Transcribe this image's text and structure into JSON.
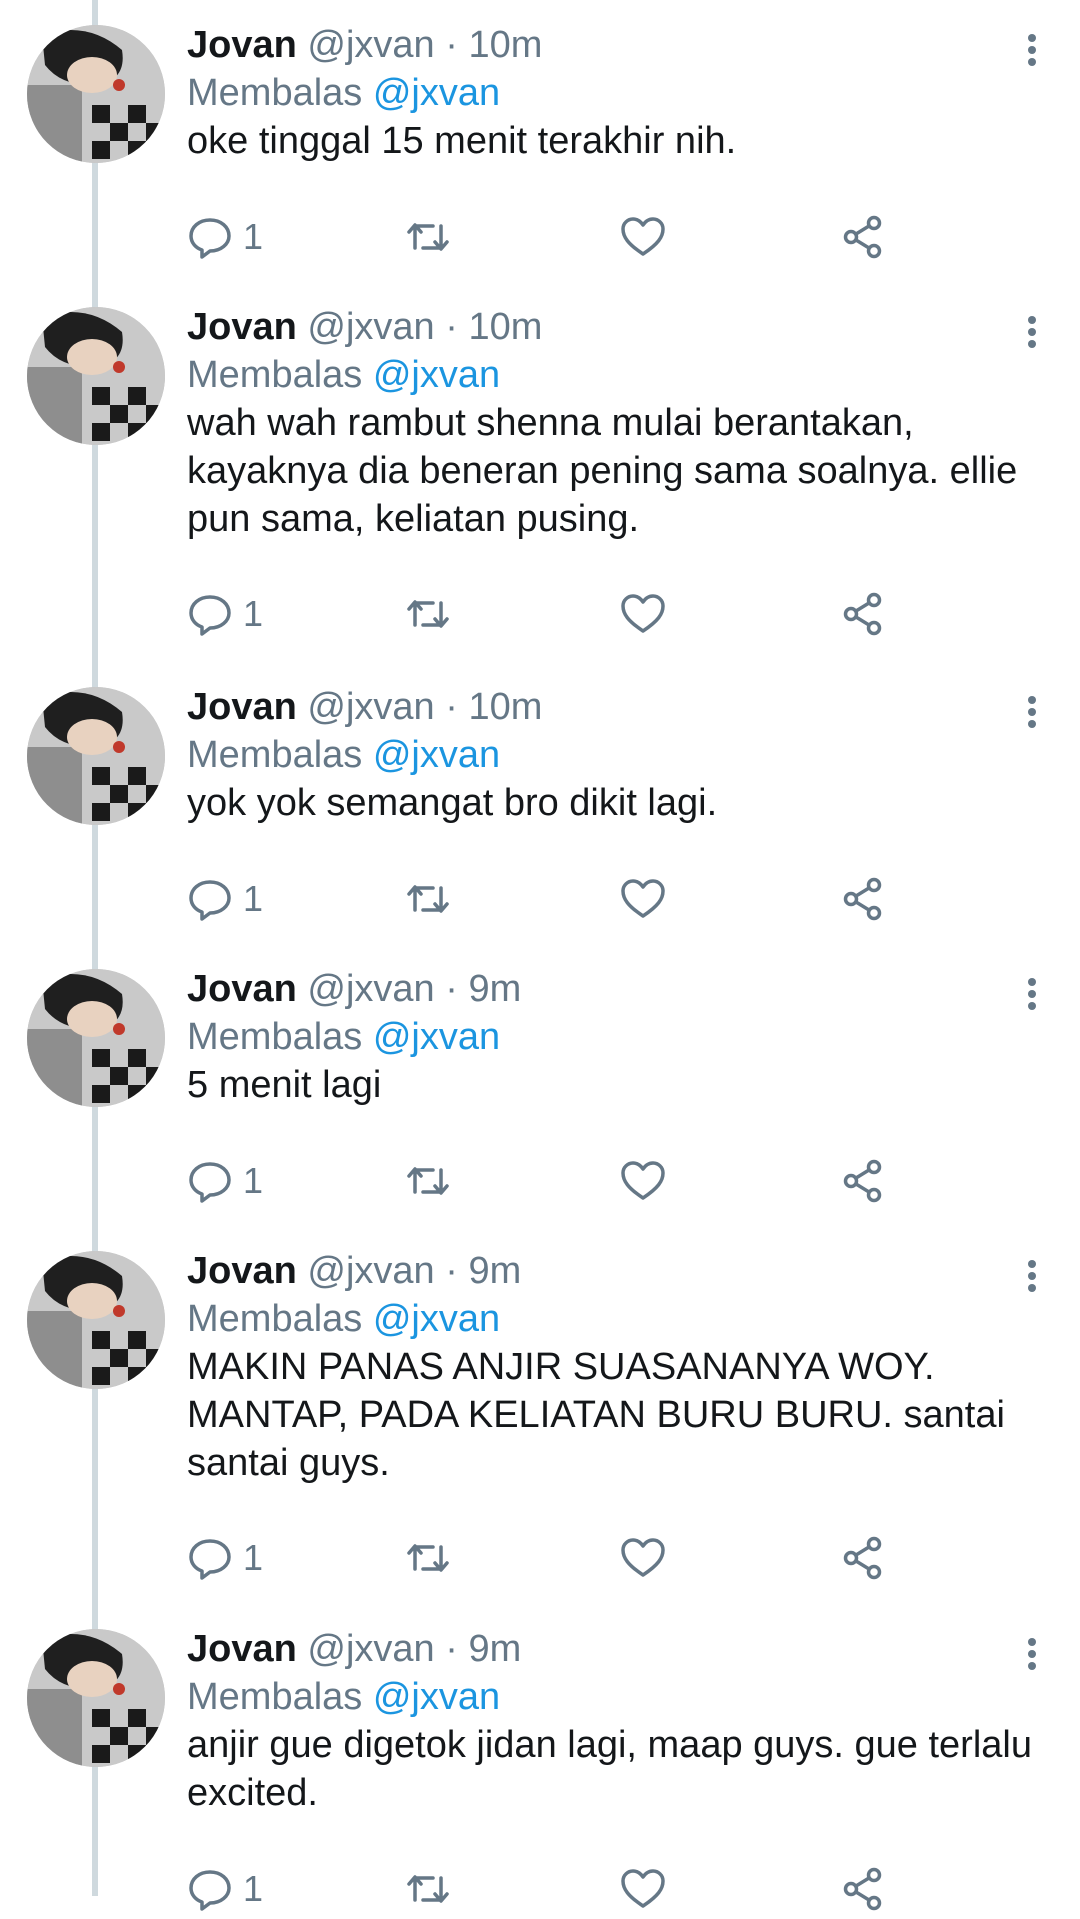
{
  "user": {
    "name": "Jovan",
    "handle": "@jxvan",
    "separator": "·",
    "reply_prefix": "Membalas",
    "reply_to": "@jxvan"
  },
  "colors": {
    "link": "#1b95e0",
    "secondary_text": "#657786",
    "primary_text": "#14171a",
    "thread_line": "#cfd9de"
  },
  "icons": [
    "reply-icon",
    "retweet-icon",
    "like-icon",
    "share-icon",
    "more-icon"
  ],
  "tweets": [
    {
      "time": "10m",
      "text": "oke tinggal 15 menit terakhir nih.",
      "reply_count": "1"
    },
    {
      "time": "10m",
      "text": "wah wah rambut shenna mulai berantakan, kayaknya dia beneran pening sama soalnya. ellie pun sama, keliatan pusing.",
      "reply_count": "1"
    },
    {
      "time": "10m",
      "text": "yok yok semangat bro dikit lagi.",
      "reply_count": "1"
    },
    {
      "time": "9m",
      "text": "5 menit lagi",
      "reply_count": "1"
    },
    {
      "time": "9m",
      "text": "MAKIN PANAS ANJIR SUASANANYA WOY. MANTAP, PADA KELIATAN BURU BURU. santai santai guys.",
      "reply_count": "1"
    },
    {
      "time": "9m",
      "text": "anjir gue digetok jidan lagi, maap guys. gue terlalu excited.",
      "reply_count": "1"
    }
  ]
}
